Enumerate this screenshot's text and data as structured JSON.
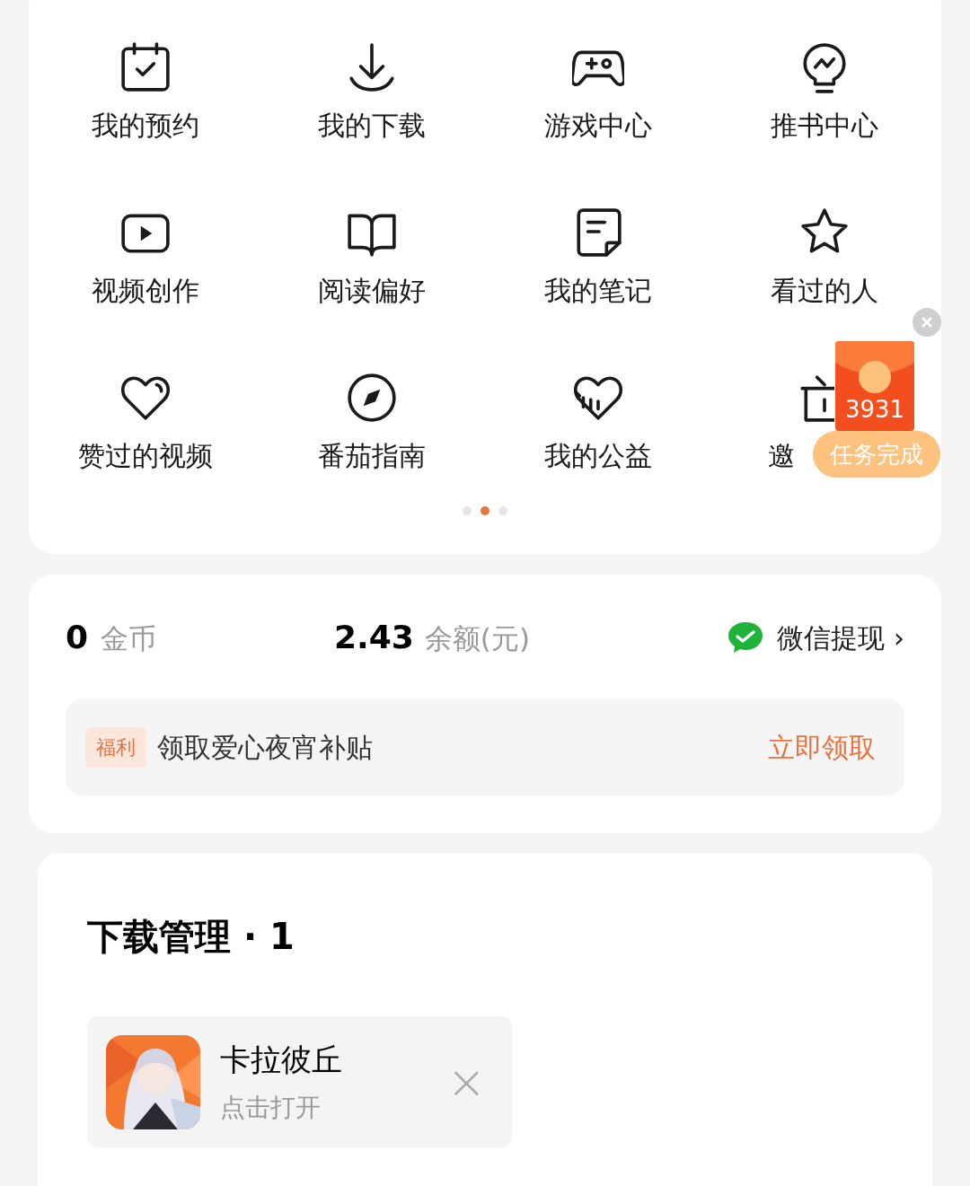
{
  "shortcuts": [
    {
      "label": "我的预约",
      "kind": "plain"
    },
    {
      "label": "我的下载",
      "kind": "plain"
    },
    {
      "label": "游戏中心",
      "kind": "plain"
    },
    {
      "label": "推书中心",
      "kind": "plain"
    },
    {
      "label": "视频创作",
      "kind": "plain"
    },
    {
      "label": "阅读偏好",
      "kind": "plain"
    },
    {
      "label": "我的笔记",
      "kind": "plain"
    },
    {
      "label": "看过的人",
      "kind": "plain"
    },
    {
      "label": "赞过的视频",
      "kind": "plain"
    },
    {
      "label": "番茄指南",
      "kind": "plain"
    },
    {
      "label": "我的公益",
      "kind": "plain"
    },
    {
      "label": "邀",
      "kind": "covered"
    }
  ],
  "pager": [
    {
      "selected": false
    },
    {
      "selected": true
    },
    {
      "selected": false
    }
  ],
  "red_packet": {
    "amount": "3931",
    "badge": "任务完成"
  },
  "wallet": {
    "coins": "0",
    "coins_label": "金币",
    "balance": "2.43",
    "balance_label": "余额(元)",
    "withdraw": "微信提现",
    "chevron": "›"
  },
  "welfare": {
    "tag": "福利",
    "text": "领取爱心夜宵补贴",
    "action": "立即领取"
  },
  "downloads": {
    "title": "下载管理 · 1",
    "items": [
      {
        "name": "卡拉彼丘",
        "status": "点击打开",
        "close": "×"
      }
    ]
  }
}
